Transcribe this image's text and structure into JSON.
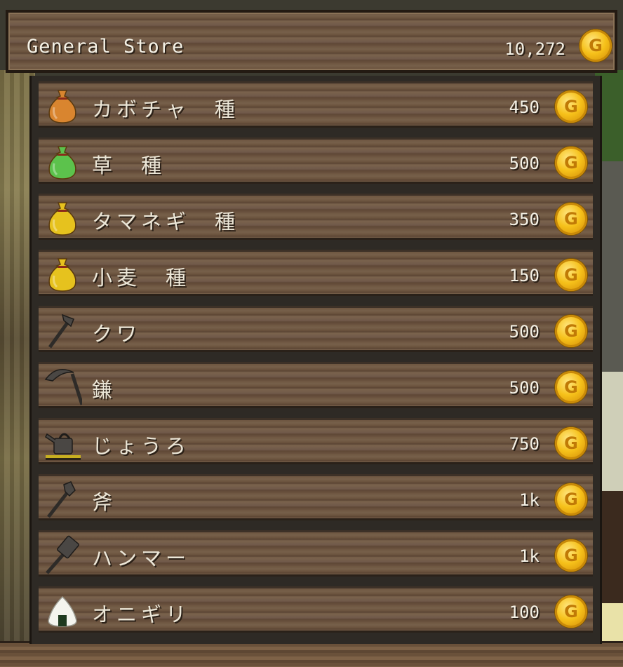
{
  "store": {
    "title": "General Store",
    "balance": "10,272",
    "currency_symbol": "G",
    "currency_icon": "gold-coin-icon"
  },
  "items": [
    {
      "name": "カボチャ　種",
      "price": "450",
      "icon": "orange-seed-bag-icon",
      "color": "#d9852f"
    },
    {
      "name": "草　種",
      "price": "500",
      "icon": "green-seed-bag-icon",
      "color": "#5cc24c"
    },
    {
      "name": "タマネギ　種",
      "price": "350",
      "icon": "yellow-seed-bag-icon",
      "color": "#e6c21e"
    },
    {
      "name": "小麦　種",
      "price": "150",
      "icon": "yellow-seed-bag-icon",
      "color": "#e6c21e"
    },
    {
      "name": "クワ",
      "price": "500",
      "icon": "hoe-icon",
      "color": "#4a4744"
    },
    {
      "name": "鎌",
      "price": "500",
      "icon": "sickle-icon",
      "color": "#4a4744"
    },
    {
      "name": "じょうろ",
      "price": "750",
      "icon": "watering-can-icon",
      "color": "#4a4744"
    },
    {
      "name": "斧",
      "price": "1k",
      "icon": "axe-icon",
      "color": "#4a4744"
    },
    {
      "name": "ハンマー",
      "price": "1k",
      "icon": "hammer-icon",
      "color": "#4a4744"
    },
    {
      "name": "オニギリ",
      "price": "100",
      "icon": "rice-ball-icon",
      "color": "#f4f4ee"
    }
  ]
}
